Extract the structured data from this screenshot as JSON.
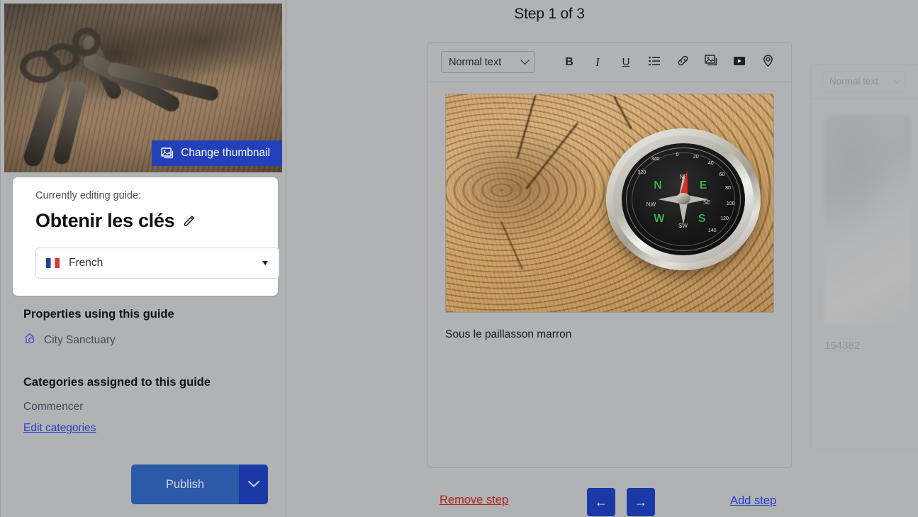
{
  "sidebar": {
    "thumbnail": {
      "alt_description": "Set of antique metal keys on a wooden table",
      "change_button_label": "Change thumbnail",
      "change_button_icon": "image-stack-icon",
      "accent_color": "#2440b8"
    },
    "guide_card": {
      "label": "Currently editing guide:",
      "title": "Obtenir les clés",
      "edit_icon": "pencil-icon",
      "language": {
        "selected": "French",
        "flag": "flag-france-icon",
        "caret_icon": "caret-down-icon"
      }
    },
    "properties_section": {
      "heading": "Properties using this guide",
      "items": [
        {
          "icon": "property-home-pin-icon",
          "name": "City Sanctuary"
        }
      ]
    },
    "categories_section": {
      "heading": "Categories assigned to this guide",
      "items": [
        "Commencer"
      ],
      "edit_link": "Edit categories"
    },
    "publish": {
      "label": "Publish",
      "caret_icon": "chevron-down-icon",
      "color": "#2c5aa8",
      "caret_color": "#1b39a6"
    }
  },
  "editor": {
    "step_title": "Step 1 of 3",
    "toolbar": {
      "style_selected": "Normal text",
      "style_caret_icon": "chevron-down-icon",
      "buttons": [
        {
          "name": "bold-button",
          "glyph": "B"
        },
        {
          "name": "italic-button",
          "glyph": "I"
        },
        {
          "name": "underline-button",
          "glyph": "U"
        },
        {
          "name": "bulleted-list-button",
          "glyph": "list-icon"
        },
        {
          "name": "link-button",
          "glyph": "link-icon"
        },
        {
          "name": "image-button",
          "glyph": "image-stack-icon"
        },
        {
          "name": "video-button",
          "glyph": "video-play-icon"
        },
        {
          "name": "location-button",
          "glyph": "location-pin-icon"
        }
      ]
    },
    "content": {
      "image_alt": "Compass resting on a cut tree stump",
      "caption": "Sous le paillasson marron"
    }
  },
  "footer": {
    "remove_step": "Remove step",
    "add_step": "Add step",
    "prev_icon": "arrow-left-icon",
    "next_icon": "arrow-right-icon",
    "prev_glyph": "←",
    "next_glyph": "→",
    "remove_color": "#b0251f",
    "link_color": "#2140c8"
  },
  "next_step_preview": {
    "style_selected": "Normal text",
    "caption": "154382"
  }
}
